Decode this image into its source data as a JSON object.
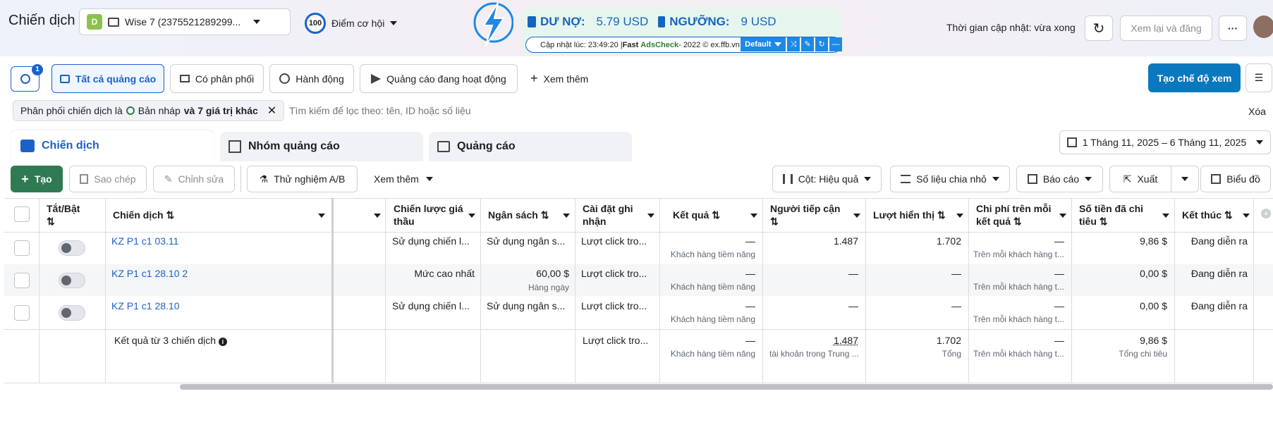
{
  "header": {
    "title": "Chiến dịch",
    "account_badge": "D",
    "account_name": "Wise 7 (2375521289299...",
    "opportunity_score": "100",
    "opportunity_label": "Điểm cơ hội",
    "update_time_label": "Thời gian cập nhật: vừa xong",
    "review_button": "Xem lại và đăng"
  },
  "extension": {
    "debt_label": "DƯ NỢ:",
    "debt_value": "5.79 USD",
    "threshold_label": "NGƯỠNG:",
    "threshold_value": "9 USD",
    "update_info_prefix": "Cập nhật lúc: 23:49:20 | ",
    "fast_label": "Fast",
    "adscheck_label": "AdsCheck",
    "update_info_suffix": " - 2022 © ex.ffb.vn",
    "default_select": "Default"
  },
  "filters": {
    "search_badge": "1",
    "tabs": [
      {
        "label": "Tất cả quảng cáo"
      },
      {
        "label": "Có phân phối"
      },
      {
        "label": "Hành động"
      },
      {
        "label": "Quảng cáo đang hoạt động"
      }
    ],
    "more_label": "Xem thêm",
    "create_view_button": "Tạo chế độ xem",
    "chip_prefix": "Phân phối chiến dịch là",
    "chip_value": "Bản nháp",
    "chip_suffix": "và 7 giá trị khác",
    "search_placeholder": "Tìm kiếm để lọc theo: tên, ID hoặc số liệu",
    "clear_label": "Xóa"
  },
  "level_tabs": [
    {
      "label": "Chiến dịch"
    },
    {
      "label": "Nhóm quảng cáo"
    },
    {
      "label": "Quảng cáo"
    }
  ],
  "date_range": "1 Tháng 11, 2025 – 6 Tháng 11, 2025",
  "toolbar": {
    "create": "Tạo",
    "copy": "Sao chép",
    "edit": "Chỉnh sửa",
    "ab_test": "Thử nghiệm A/B",
    "more": "Xem thêm",
    "columns": "Cột: Hiệu quả",
    "breakdown": "Số liệu chia nhỏ",
    "reports": "Báo cáo",
    "export": "Xuất",
    "chart": "Biểu đồ"
  },
  "table": {
    "headers": {
      "toggle": "Tắt/Bật",
      "campaign": "Chiến dịch",
      "bid_strategy": "Chiến lược giá thầu",
      "budget": "Ngân sách",
      "attribution": "Cài đặt ghi nhận",
      "results": "Kết quả",
      "reach": "Người tiếp cận",
      "impressions": "Lượt hiển thị",
      "cost_per_result": "Chi phí trên mỗi kết quả",
      "amount_spent": "Số tiền đã chi tiêu",
      "ends": "Kết thúc"
    },
    "rows": [
      {
        "name": "KZ P1 c1 03.11",
        "bid": "Sử dụng chiến l...",
        "budget": "Sử dụng ngân s...",
        "budget_sub": "",
        "attribution": "Lượt click tro...",
        "results": "—",
        "results_sub": "Khách hàng tiềm năng",
        "reach": "1.487",
        "impressions": "1.702",
        "cpr": "—",
        "cpr_sub": "Trên mỗi khách hàng t...",
        "spent": "9,86 $",
        "ends": "Đang diễn ra"
      },
      {
        "name": "KZ P1 c1 28.10 2",
        "bid": "Mức cao nhất",
        "budget": "60,00 $",
        "budget_sub": "Hàng ngày",
        "attribution": "Lượt click tro...",
        "results": "—",
        "results_sub": "Khách hàng tiềm năng",
        "reach": "—",
        "impressions": "—",
        "cpr": "—",
        "cpr_sub": "Trên mỗi khách hàng t...",
        "spent": "0,00 $",
        "ends": "Đang diễn ra"
      },
      {
        "name": "KZ P1 c1 28.10",
        "bid": "Sử dụng chiến l...",
        "budget": "Sử dụng ngân s...",
        "budget_sub": "",
        "attribution": "Lượt click tro...",
        "results": "—",
        "results_sub": "Khách hàng tiềm năng",
        "reach": "—",
        "impressions": "—",
        "cpr": "—",
        "cpr_sub": "Trên mỗi khách hàng t...",
        "spent": "0,00 $",
        "ends": "Đang diễn ra"
      }
    ],
    "summary": {
      "label": "Kết quả từ 3 chiến dịch",
      "attribution": "Lượt click tro...",
      "results": "—",
      "results_sub": "Khách hàng tiềm năng",
      "reach": "1.487",
      "reach_sub": "tài khoản trong Trung ...",
      "impressions": "1.702",
      "impressions_sub": "Tổng",
      "cpr": "—",
      "cpr_sub": "Trên mỗi khách hàng t...",
      "spent": "9,86 $",
      "spent_sub": "Tổng chi tiêu"
    }
  }
}
